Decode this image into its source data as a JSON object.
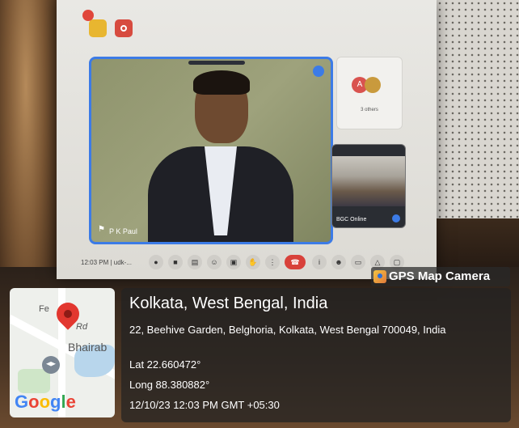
{
  "meeting": {
    "time": "12:03 PM | udk-...",
    "speaker_name": "P K Paul",
    "others_label": "3 others",
    "room_tile_label": "BGC Online",
    "avatar_initial": "A",
    "controls": [
      "mic-icon",
      "camera-icon",
      "captions-icon",
      "emoji-icon",
      "present-icon",
      "raise-hand-icon",
      "more-icon",
      "end-call-icon",
      "info-icon",
      "people-icon",
      "chat-icon",
      "activities-icon",
      "lock-icon"
    ]
  },
  "gps": {
    "app_name": "GPS Map Camera",
    "city": "Kolkata, West Bengal, India",
    "address": "22, Beehive Garden, Belghoria, Kolkata, West Bengal 700049, India",
    "lat": "Lat 22.660472°",
    "long": "Long 88.380882°",
    "datetime": "12/10/23 12:03 PM GMT +05:30"
  },
  "map": {
    "label_fe": "Fe",
    "label_rd": "Rd",
    "label_bhairab": "Bhairab",
    "logo": [
      "G",
      "o",
      "o",
      "g",
      "l",
      "e"
    ]
  },
  "colors": {
    "meet_blue": "#3c7be6",
    "end_call_red": "#d8413a",
    "map_pin_red": "#e2372f"
  }
}
